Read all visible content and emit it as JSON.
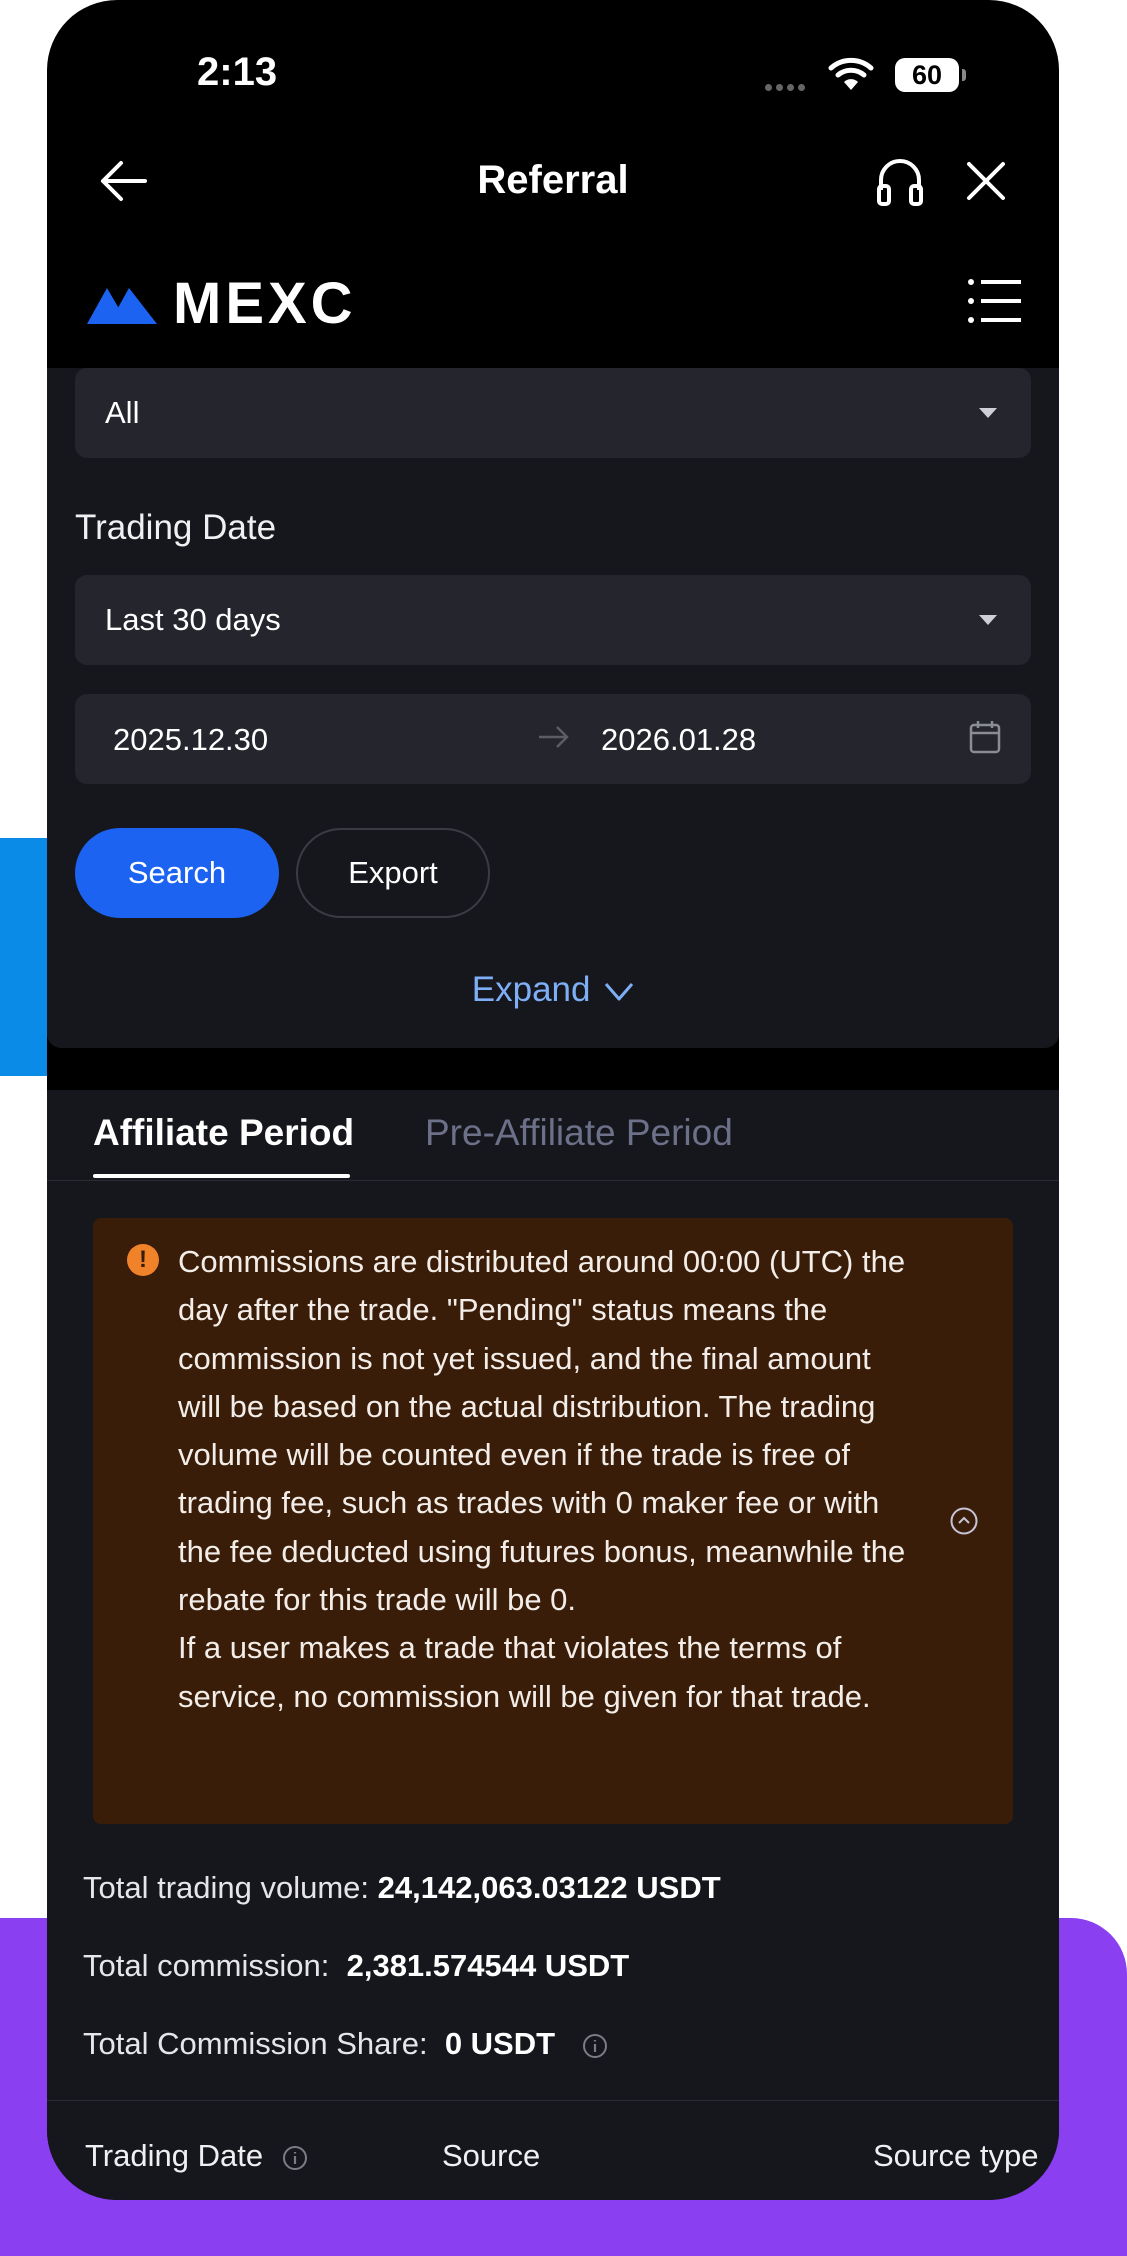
{
  "status_bar": {
    "time": "2:13",
    "battery": "60"
  },
  "nav": {
    "title": "Referral"
  },
  "brand": {
    "logo_text": "MEXC"
  },
  "filters": {
    "type_select": "All",
    "trading_date_label": "Trading Date",
    "period_select": "Last 30 days",
    "start_date": "2025.12.30",
    "end_date": "2026.01.28",
    "search_label": "Search",
    "export_label": "Export",
    "expand_label": "Expand"
  },
  "tabs": [
    {
      "label": "Affiliate Period",
      "active": true
    },
    {
      "label": "Pre-Affiliate Period",
      "active": false
    }
  ],
  "notice": {
    "paragraph_1": "Commissions are distributed around 00:00 (UTC) the day after the trade. \"Pending\" status means the commission is not yet issued, and the final amount will be based on the actual distribution. The trading volume will be counted even if the trade is free of trading fee, such as trades with 0 maker fee or with the fee deducted using futures bonus, meanwhile the rebate for this trade will be 0.",
    "paragraph_2": "If a user makes a trade that violates the terms of service, no commission will be given for that trade."
  },
  "stats": {
    "volume_label": "Total trading volume:",
    "volume_value": "24,142,063.03122 USDT",
    "commission_label": "Total commission:",
    "commission_value": "2,381.574544 USDT",
    "share_label": "Total Commission Share:",
    "share_value": "0 USDT"
  },
  "table": {
    "columns": [
      "Trading Date",
      "Source",
      "Source type"
    ]
  },
  "colors": {
    "accent": "#1d63f2",
    "link": "#7eaef5",
    "notice_bg": "#3a1d08",
    "warning": "#f0822a",
    "bg_purple": "#8a3ff0",
    "bg_blue": "#0b8be8"
  }
}
